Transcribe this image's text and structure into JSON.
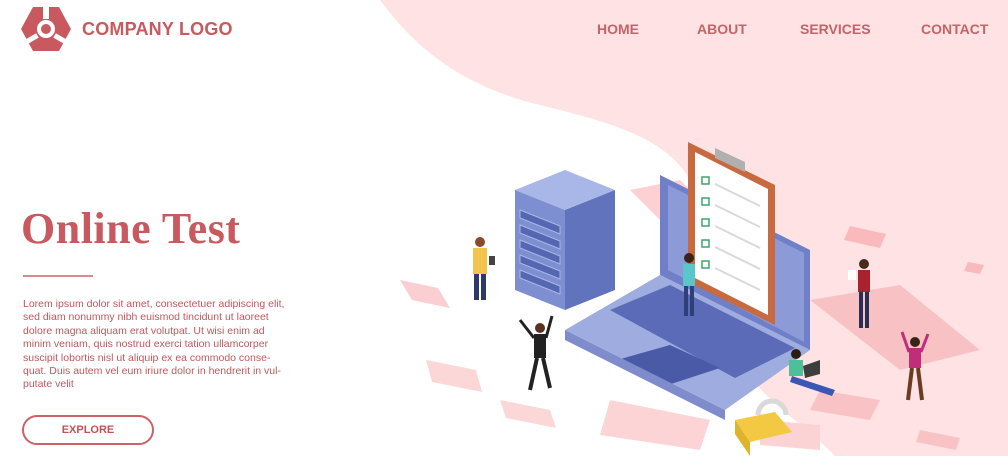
{
  "brand": {
    "name": "COMPANY LOGO"
  },
  "nav": {
    "items": [
      "HOME",
      "ABOUT",
      "SERVICES",
      "CONTACT"
    ]
  },
  "hero": {
    "title": "Online Test",
    "body": "Lorem ipsum dolor sit amet, consectetuer adipiscing elit,\nsed diam nonummy nibh euismod tincidunt ut laoreet\ndolore magna aliquam erat volutpat. Ut wisi enim ad\nminim veniam, quis nostrud exerci tation ullamcorper\nsuscipit lobortis nisl ut aliquip ex ea commodo conse-\nquat. Duis autem vel eum iriure dolor in hendrerit in vul-\nputate velit",
    "cta": "EXPLORE"
  },
  "colors": {
    "brand": "#c85a5f",
    "blob": "#ffe3e4",
    "laptop": "#6f80c8",
    "server": "#7d8fd0",
    "clipboard": "#c86a3f"
  }
}
